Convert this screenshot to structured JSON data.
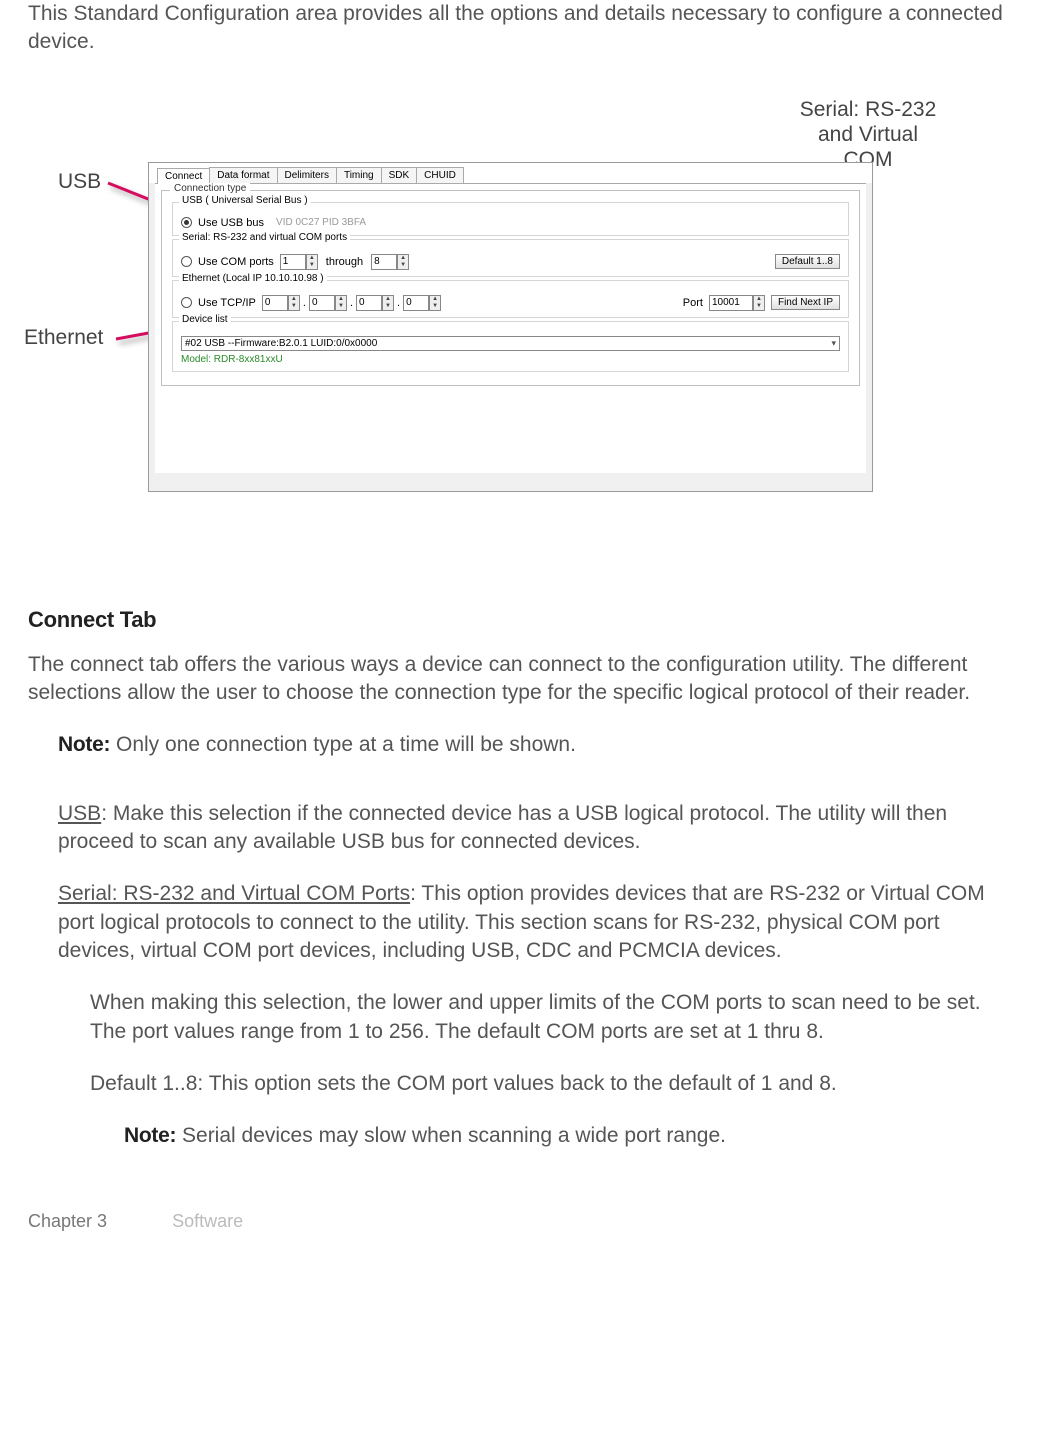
{
  "intro": "This Standard Configuration area provides all the options and details necessary to configure a connected device.",
  "callouts": {
    "usb": "USB",
    "serial_line1": "Serial: RS-232",
    "serial_line2": "and Virtual",
    "serial_line3": "COM",
    "ethernet": "Ethernet"
  },
  "win": {
    "tabs": [
      "Connect",
      "Data format",
      "Delimiters",
      "Timing",
      "SDK",
      "CHUID"
    ],
    "group_title": "Connection type",
    "usb_sub_title": "USB ( Universal Serial Bus )",
    "usb_radio_label": "Use USB bus",
    "usb_detail": "VID 0C27 PID 3BFA",
    "serial_sub_title": "Serial: RS-232 and virtual COM ports",
    "serial_radio_label": "Use COM ports",
    "serial_from": "1",
    "serial_to_word": "through",
    "serial_to": "8",
    "serial_default_btn": "Default 1..8",
    "eth_sub_title": "Ethernet (Local IP 10.10.10.98 )",
    "eth_radio_label": "Use TCP/IP",
    "eth_ip_a": "0",
    "eth_ip_b": "0",
    "eth_ip_c": "0",
    "eth_ip_d": "0",
    "eth_port_label": "Port",
    "eth_port": "10001",
    "eth_find_btn": "Find Next IP",
    "devlist_title": "Device list",
    "devlist_value": "#02 USB --Firmware:B2.0.1 LUID:0/0x0000",
    "model": "Model: RDR-8xx81xxU"
  },
  "section_heading": "Connect Tab",
  "p1": "The connect tab offers the various ways a device can connect to the configuration utility. The different selections allow the user to choose the connection type for the specific logical protocol of their reader.",
  "note1_label": "Note:",
  "note1_text": " Only one connection type at a time will be shown.",
  "usb_u": "USB",
  "usb_body": ": Make this selection if the connected device has a USB logical protocol. The utility will then proceed to scan any available USB bus for connected devices.",
  "ser_u": "Serial: RS-232 and Virtual COM Ports",
  "ser_body": ": This option provides devices that are RS-232 or Virtual COM port logical protocols to connect to the utility. This section scans for RS-232, physical COM port devices, virtual COM port devices, including USB, CDC and PCMCIA devices.",
  "ser_sub1": "When making this selection, the lower and upper limits of the COM ports to scan need to be set. The port values range from 1 to 256. The default COM ports are set at 1 thru 8.",
  "ser_sub2": "Default 1..8: This option sets the COM port values back to the default of 1 and 8.",
  "note2_label": "Note:",
  "note2_text": " Serial devices may slow when scanning a wide port range.",
  "footer_chapter": "Chapter 3",
  "footer_section": "Software"
}
